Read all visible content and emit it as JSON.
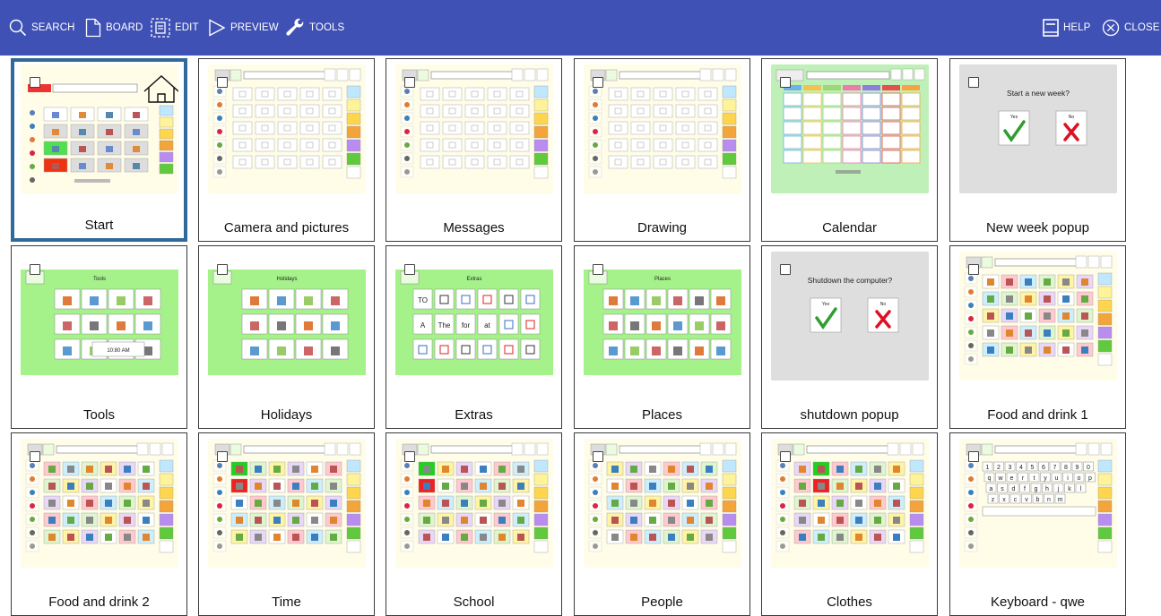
{
  "toolbar": {
    "search": "SEARCH",
    "board": "BOARD",
    "edit": "EDIT",
    "preview": "PREVIEW",
    "tools": "TOOLS",
    "help": "HELP",
    "close": "CLOSE"
  },
  "colors": {
    "toolbar_bg": "#3f51b5",
    "selected_border": "#2f6a9a",
    "board_bg": "#fffde8",
    "popup_bg": "#dedede",
    "green_bg": "#a6f28a"
  },
  "tiles": [
    {
      "label": "Start",
      "kind": "start"
    },
    {
      "label": "Camera and pictures",
      "kind": "grid"
    },
    {
      "label": "Messages",
      "kind": "grid"
    },
    {
      "label": "Drawing",
      "kind": "grid"
    },
    {
      "label": "Calendar",
      "kind": "calendar"
    },
    {
      "label": "New week popup",
      "kind": "popup",
      "question": "Start a new week?",
      "yes": "Yes",
      "no": "No"
    },
    {
      "label": "Tools",
      "kind": "green",
      "heading": "Tools",
      "time": "10:80 AM"
    },
    {
      "label": "Holidays",
      "kind": "green",
      "heading": "Holidays"
    },
    {
      "label": "Extras",
      "kind": "extras",
      "heading": "Extras",
      "words": [
        "TO",
        "A",
        "The",
        "for",
        "at"
      ]
    },
    {
      "label": "Places",
      "kind": "green",
      "heading": "Places"
    },
    {
      "label": "shutdown popup",
      "kind": "popup",
      "question": "Shutdown the computer?",
      "yes": "Yes",
      "no": "No"
    },
    {
      "label": "Food and drink 1",
      "kind": "symbols"
    },
    {
      "label": "Food and drink 2",
      "kind": "symbols"
    },
    {
      "label": "Time",
      "kind": "symbols"
    },
    {
      "label": "School",
      "kind": "symbols"
    },
    {
      "label": "People",
      "kind": "symbols"
    },
    {
      "label": "Clothes",
      "kind": "symbols"
    },
    {
      "label": "Keyboard - qwe",
      "kind": "keyboard",
      "rows": [
        "1 2 3 4 5 6 7 8 9 0",
        "q w e r t y u i o p",
        "a s d f g h j k l",
        "z x c v b n m"
      ]
    }
  ]
}
